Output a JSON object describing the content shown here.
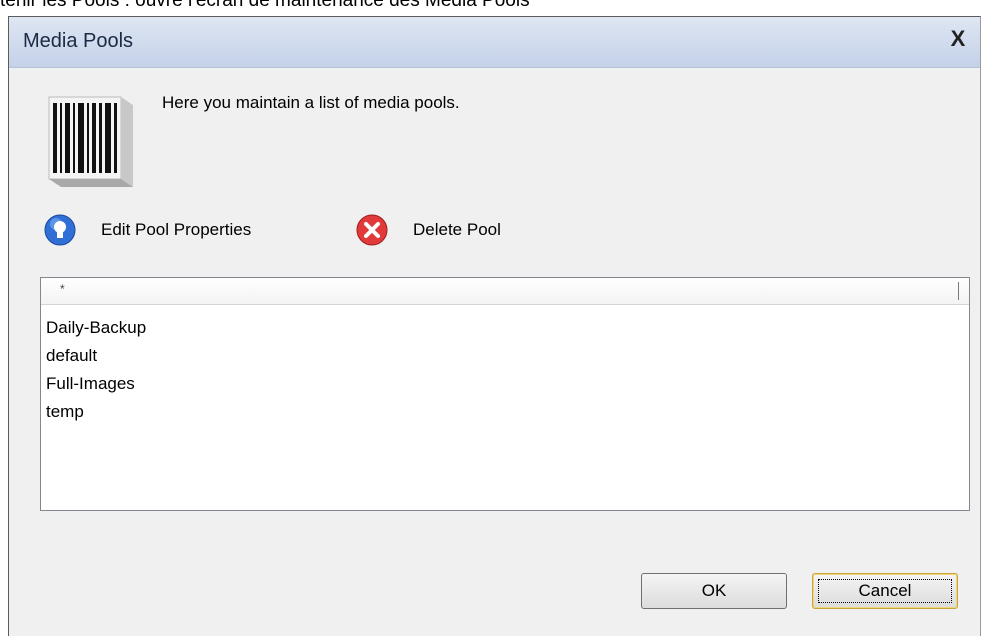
{
  "caption": "tenir les Pools : ouvre l'écran de maintenance des Media Pools",
  "window": {
    "title": "Media Pools",
    "close_label": "X",
    "description": "Here you maintain a list of media pools."
  },
  "actions": {
    "edit_label": "Edit Pool Properties",
    "delete_label": "Delete Pool"
  },
  "list": {
    "header": "*",
    "items": [
      "Daily-Backup",
      "default",
      "Full-Images",
      "temp"
    ]
  },
  "buttons": {
    "ok_label": "OK",
    "cancel_label": "Cancel"
  },
  "colors": {
    "edit_icon": "#2f6fd6",
    "delete_icon": "#e23a3a"
  }
}
